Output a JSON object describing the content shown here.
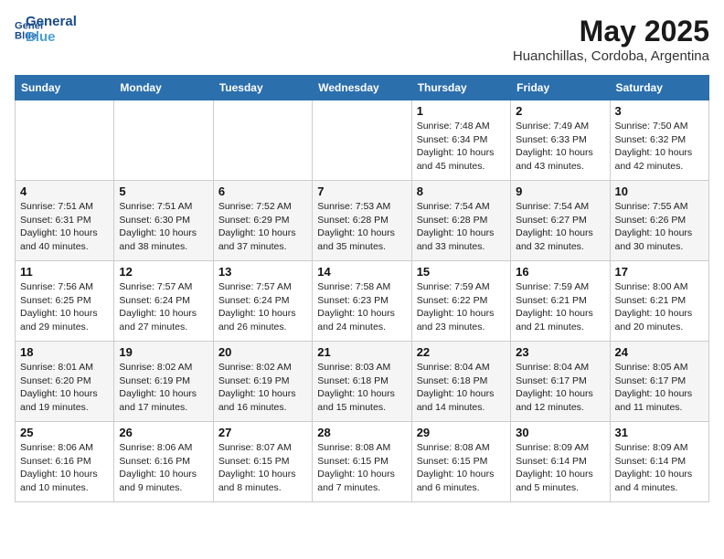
{
  "header": {
    "logo_line1": "General",
    "logo_line2": "Blue",
    "month": "May 2025",
    "location": "Huanchillas, Cordoba, Argentina"
  },
  "weekdays": [
    "Sunday",
    "Monday",
    "Tuesday",
    "Wednesday",
    "Thursday",
    "Friday",
    "Saturday"
  ],
  "weeks": [
    [
      {
        "day": "",
        "info": ""
      },
      {
        "day": "",
        "info": ""
      },
      {
        "day": "",
        "info": ""
      },
      {
        "day": "",
        "info": ""
      },
      {
        "day": "1",
        "info": "Sunrise: 7:48 AM\nSunset: 6:34 PM\nDaylight: 10 hours\nand 45 minutes."
      },
      {
        "day": "2",
        "info": "Sunrise: 7:49 AM\nSunset: 6:33 PM\nDaylight: 10 hours\nand 43 minutes."
      },
      {
        "day": "3",
        "info": "Sunrise: 7:50 AM\nSunset: 6:32 PM\nDaylight: 10 hours\nand 42 minutes."
      }
    ],
    [
      {
        "day": "4",
        "info": "Sunrise: 7:51 AM\nSunset: 6:31 PM\nDaylight: 10 hours\nand 40 minutes."
      },
      {
        "day": "5",
        "info": "Sunrise: 7:51 AM\nSunset: 6:30 PM\nDaylight: 10 hours\nand 38 minutes."
      },
      {
        "day": "6",
        "info": "Sunrise: 7:52 AM\nSunset: 6:29 PM\nDaylight: 10 hours\nand 37 minutes."
      },
      {
        "day": "7",
        "info": "Sunrise: 7:53 AM\nSunset: 6:28 PM\nDaylight: 10 hours\nand 35 minutes."
      },
      {
        "day": "8",
        "info": "Sunrise: 7:54 AM\nSunset: 6:28 PM\nDaylight: 10 hours\nand 33 minutes."
      },
      {
        "day": "9",
        "info": "Sunrise: 7:54 AM\nSunset: 6:27 PM\nDaylight: 10 hours\nand 32 minutes."
      },
      {
        "day": "10",
        "info": "Sunrise: 7:55 AM\nSunset: 6:26 PM\nDaylight: 10 hours\nand 30 minutes."
      }
    ],
    [
      {
        "day": "11",
        "info": "Sunrise: 7:56 AM\nSunset: 6:25 PM\nDaylight: 10 hours\nand 29 minutes."
      },
      {
        "day": "12",
        "info": "Sunrise: 7:57 AM\nSunset: 6:24 PM\nDaylight: 10 hours\nand 27 minutes."
      },
      {
        "day": "13",
        "info": "Sunrise: 7:57 AM\nSunset: 6:24 PM\nDaylight: 10 hours\nand 26 minutes."
      },
      {
        "day": "14",
        "info": "Sunrise: 7:58 AM\nSunset: 6:23 PM\nDaylight: 10 hours\nand 24 minutes."
      },
      {
        "day": "15",
        "info": "Sunrise: 7:59 AM\nSunset: 6:22 PM\nDaylight: 10 hours\nand 23 minutes."
      },
      {
        "day": "16",
        "info": "Sunrise: 7:59 AM\nSunset: 6:21 PM\nDaylight: 10 hours\nand 21 minutes."
      },
      {
        "day": "17",
        "info": "Sunrise: 8:00 AM\nSunset: 6:21 PM\nDaylight: 10 hours\nand 20 minutes."
      }
    ],
    [
      {
        "day": "18",
        "info": "Sunrise: 8:01 AM\nSunset: 6:20 PM\nDaylight: 10 hours\nand 19 minutes."
      },
      {
        "day": "19",
        "info": "Sunrise: 8:02 AM\nSunset: 6:19 PM\nDaylight: 10 hours\nand 17 minutes."
      },
      {
        "day": "20",
        "info": "Sunrise: 8:02 AM\nSunset: 6:19 PM\nDaylight: 10 hours\nand 16 minutes."
      },
      {
        "day": "21",
        "info": "Sunrise: 8:03 AM\nSunset: 6:18 PM\nDaylight: 10 hours\nand 15 minutes."
      },
      {
        "day": "22",
        "info": "Sunrise: 8:04 AM\nSunset: 6:18 PM\nDaylight: 10 hours\nand 14 minutes."
      },
      {
        "day": "23",
        "info": "Sunrise: 8:04 AM\nSunset: 6:17 PM\nDaylight: 10 hours\nand 12 minutes."
      },
      {
        "day": "24",
        "info": "Sunrise: 8:05 AM\nSunset: 6:17 PM\nDaylight: 10 hours\nand 11 minutes."
      }
    ],
    [
      {
        "day": "25",
        "info": "Sunrise: 8:06 AM\nSunset: 6:16 PM\nDaylight: 10 hours\nand 10 minutes."
      },
      {
        "day": "26",
        "info": "Sunrise: 8:06 AM\nSunset: 6:16 PM\nDaylight: 10 hours\nand 9 minutes."
      },
      {
        "day": "27",
        "info": "Sunrise: 8:07 AM\nSunset: 6:15 PM\nDaylight: 10 hours\nand 8 minutes."
      },
      {
        "day": "28",
        "info": "Sunrise: 8:08 AM\nSunset: 6:15 PM\nDaylight: 10 hours\nand 7 minutes."
      },
      {
        "day": "29",
        "info": "Sunrise: 8:08 AM\nSunset: 6:15 PM\nDaylight: 10 hours\nand 6 minutes."
      },
      {
        "day": "30",
        "info": "Sunrise: 8:09 AM\nSunset: 6:14 PM\nDaylight: 10 hours\nand 5 minutes."
      },
      {
        "day": "31",
        "info": "Sunrise: 8:09 AM\nSunset: 6:14 PM\nDaylight: 10 hours\nand 4 minutes."
      }
    ]
  ]
}
